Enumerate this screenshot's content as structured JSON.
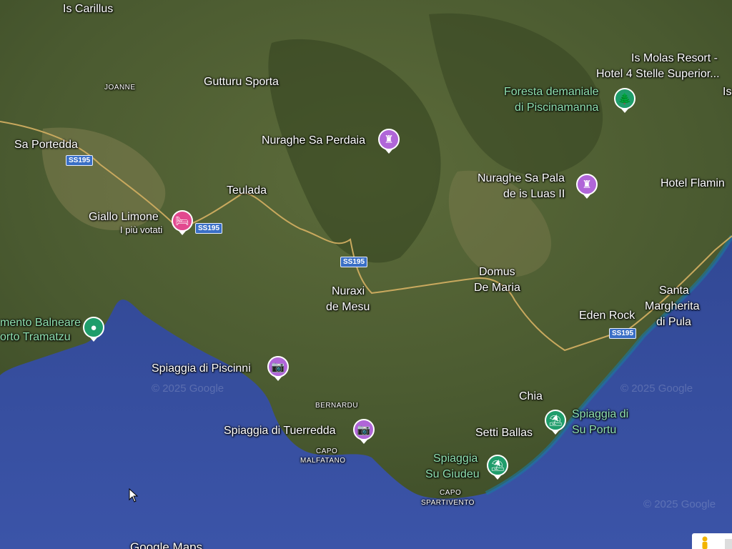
{
  "map": {
    "attribution": "Google Maps",
    "watermarks": [
      "© 2025 Google",
      "© 2025 Google",
      "© 2025 Google"
    ]
  },
  "places": {
    "is_carillus": "Is Carillus",
    "joanne": "JOANNE",
    "gutturu_sporta": "Gutturu Sporta",
    "sa_portedda": "Sa Portedda",
    "teulada": "Teulada",
    "giallo_limone": "Giallo Limone",
    "giallo_limone_sub": "I più votati",
    "nuraghe_sa_perdaia": "Nuraghe Sa Perdaia",
    "is_molas_1": "Is Molas Resort -",
    "is_molas_2": "Hotel 4 Stelle Superior...",
    "is_cut": "Is",
    "foresta_1": "Foresta demaniale",
    "foresta_2": "di Piscinamanna",
    "nuraghe_sa_pala_1": "Nuraghe Sa Pala",
    "nuraghe_sa_pala_2": "de is Luas II",
    "hotel_flamingo": "Hotel Flamin",
    "nuraxi_1": "Nuraxi",
    "nuraxi_2": "de Mesu",
    "domus_1": "Domus",
    "domus_2": "De Maria",
    "santa_1": "Santa",
    "santa_2": "Margherita",
    "santa_3": "di Pula",
    "eden_rock": "Eden Rock",
    "stab_1": "mento Balneare",
    "stab_2": "orto Tramatzu",
    "spiaggia_piscinni": "Spiaggia di Piscinni",
    "bernardu": "BERNARDU",
    "chia": "Chia",
    "spiaggia_su_portu_1": "Spiaggia di",
    "spiaggia_su_portu_2": "Su Portu",
    "setti_ballas": "Setti Ballas",
    "spiaggia_tuerredda": "Spiaggia di Tuerredda",
    "capo_malfatano_1": "CAPO",
    "capo_malfatano_2": "MALFATANO",
    "spiaggia_su_giudeu_1": "Spiaggia",
    "spiaggia_su_giudeu_2": "Su Giudeu",
    "capo_spartivento_1": "CAPO",
    "capo_spartivento_2": "SPARTIVENTO"
  },
  "roads": [
    "SS195",
    "SS195",
    "SS195",
    "SS195"
  ],
  "icons": {
    "castle": "castle-icon",
    "hotel": "hotel-icon",
    "tree": "tree-icon",
    "camera": "camera-icon",
    "beach": "beach-icon",
    "pin": "location-pin-icon",
    "pegman": "pegman-icon"
  },
  "colors": {
    "sea": "#1f2f66",
    "land": "#4a5a2e",
    "road": "#b89a55",
    "poi_purple": "#b065d8",
    "poi_pink": "#e2498f",
    "poi_green": "#1f9d6b"
  }
}
